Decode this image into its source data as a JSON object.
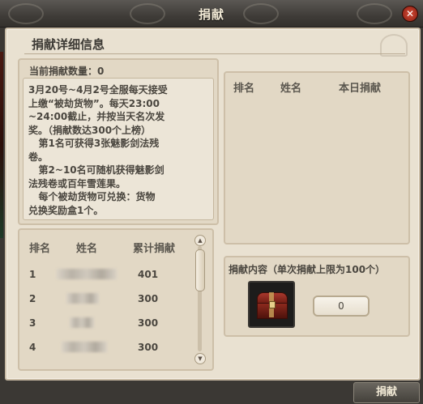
{
  "window": {
    "title": "捐献",
    "close_glyph": "✕",
    "section_title": "捐献详细信息"
  },
  "current": {
    "label": "当前捐献数量：",
    "value": "0"
  },
  "description": "3月20号~4月2号全服每天接受\n上缴“被劫货物”。每天23:00\n~24:00截止，并按当天名次发\n奖。（捐献数达300个上榜）\n   第1名可获得3张魅影剑法残\n卷。\n   第2~10名可随机获得魅影剑\n法残卷或百年雪莲果。\n   每个被劫货物可兑换：货物\n兑换奖励盒1个。",
  "total_ranking": {
    "headers": [
      "排名",
      "姓名",
      "累计捐献"
    ],
    "rows": [
      {
        "rank": "1",
        "value": "401"
      },
      {
        "rank": "2",
        "value": "300"
      },
      {
        "rank": "3",
        "value": "300"
      },
      {
        "rank": "4",
        "value": "300"
      }
    ]
  },
  "today_ranking": {
    "headers": [
      "排名",
      "姓名",
      "本日捐献"
    ]
  },
  "donate": {
    "label": "捐献内容（单次捐献上限为100个）",
    "item_icon": "treasure-chest-icon",
    "quantity": "0"
  },
  "donate_button": "捐献"
}
